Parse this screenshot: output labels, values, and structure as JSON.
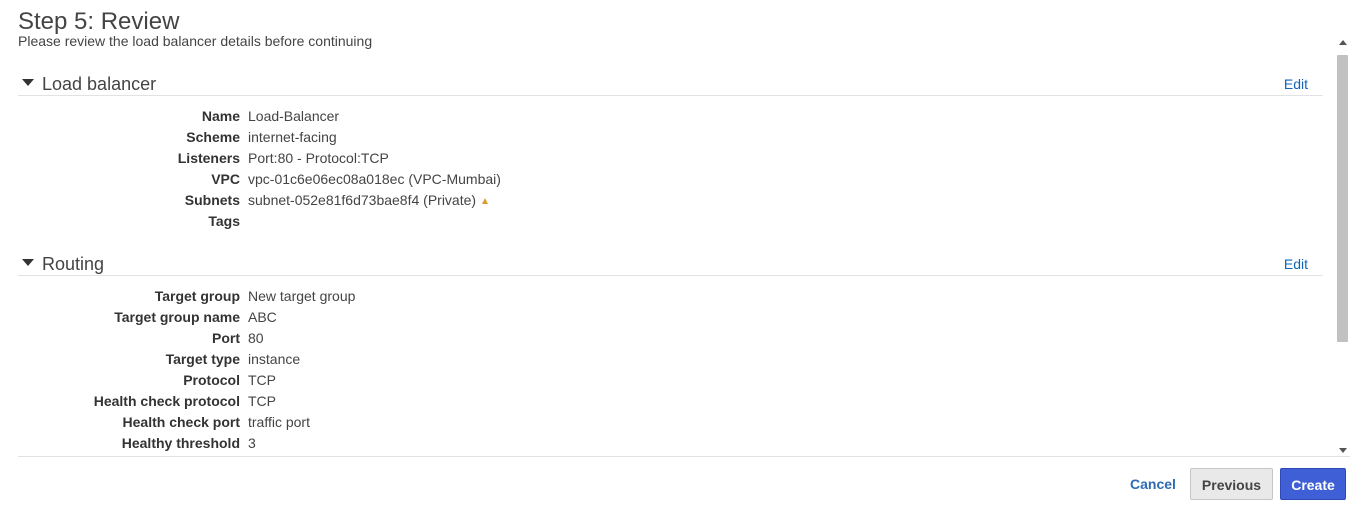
{
  "header": {
    "title": "Step 5: Review",
    "subtitle": "Please review the load balancer details before continuing"
  },
  "sections": {
    "load_balancer": {
      "title": "Load balancer",
      "edit_label": "Edit",
      "rows": [
        {
          "label": "Name",
          "value": "Load-Balancer"
        },
        {
          "label": "Scheme",
          "value": "internet-facing"
        },
        {
          "label": "Listeners",
          "value": "Port:80 - Protocol:TCP"
        },
        {
          "label": "VPC",
          "value": "vpc-01c6e06ec08a018ec (VPC-Mumbai)"
        },
        {
          "label": "Subnets",
          "value": "subnet-052e81f6d73bae8f4 (Private)"
        },
        {
          "label": "Tags",
          "value": ""
        }
      ]
    },
    "routing": {
      "title": "Routing",
      "edit_label": "Edit",
      "rows": [
        {
          "label": "Target group",
          "value": "New target group"
        },
        {
          "label": "Target group name",
          "value": "ABC"
        },
        {
          "label": "Port",
          "value": "80"
        },
        {
          "label": "Target type",
          "value": "instance"
        },
        {
          "label": "Protocol",
          "value": "TCP"
        },
        {
          "label": "Health check protocol",
          "value": "TCP"
        },
        {
          "label": "Health check port",
          "value": "traffic port"
        },
        {
          "label": "Healthy threshold",
          "value": "3"
        }
      ]
    }
  },
  "footer": {
    "cancel_label": "Cancel",
    "previous_label": "Previous",
    "create_label": "Create"
  },
  "colors": {
    "link": "#1166bb",
    "primary_button": "#3f5fd7",
    "warning": "#e09a2d"
  }
}
